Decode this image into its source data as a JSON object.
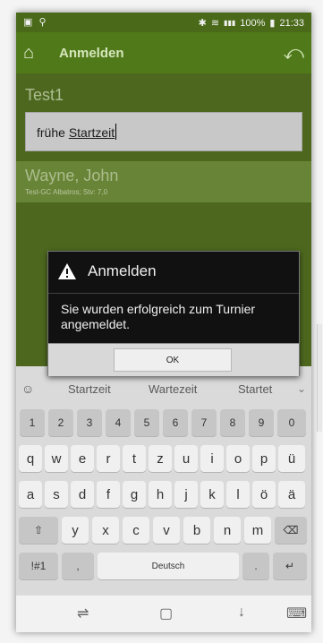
{
  "statusbar": {
    "left_icons": "▣ ⚲",
    "bluetooth": "✱",
    "wifi": "≋",
    "signal": "▮▮▮",
    "battery_pct": "100%",
    "battery_icon": "▮",
    "time": "21:33"
  },
  "appbar": {
    "title": "Anmelden",
    "home_icon": "⌂",
    "back_icon": "⤺"
  },
  "content": {
    "group_title": "Test1",
    "input_value_prefix": "frühe",
    "input_value_underlined": "Startzeit",
    "player_name": "Wayne, John",
    "player_info": "Test-GC Albatros; Stv: 7,0"
  },
  "dialog": {
    "title": "Anmelden",
    "message": "Sie wurden erfolgreich zum Turnier angemeldet.",
    "ok_label": "OK"
  },
  "keyboard": {
    "suggestions": [
      "Startzeit",
      "Wartezeit",
      "Startet"
    ],
    "suggest_icon": "☺",
    "chevron_icon": "⌄",
    "row_numbers": [
      "1",
      "2",
      "3",
      "4",
      "5",
      "6",
      "7",
      "8",
      "9",
      "0"
    ],
    "row_q": [
      "q",
      "w",
      "e",
      "r",
      "t",
      "z",
      "u",
      "i",
      "o",
      "p",
      "ü"
    ],
    "row_a": [
      "a",
      "s",
      "d",
      "f",
      "g",
      "h",
      "j",
      "k",
      "l",
      "ö",
      "ä"
    ],
    "row_y": [
      "y",
      "x",
      "c",
      "v",
      "b",
      "n",
      "m"
    ],
    "shift_icon": "⇧",
    "backspace_icon": "⌫",
    "symbols_label": "!#1",
    "comma": ",",
    "space_label": "Deutsch",
    "period": ".",
    "enter_icon": "↵"
  },
  "navbar": {
    "recents_icon": "⇌",
    "home_icon": "▢",
    "back_icon": "↓",
    "keyboard_icon": "⌨"
  }
}
